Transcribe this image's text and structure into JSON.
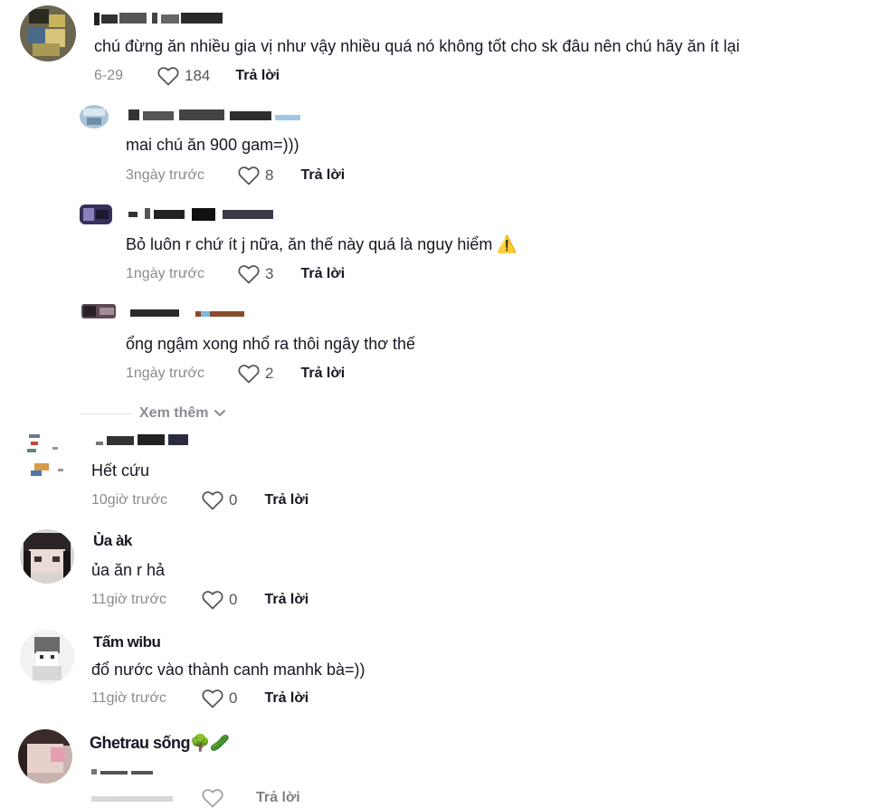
{
  "comments": [
    {
      "name": "",
      "text": "chú đừng ăn nhiều gia vị như vậy nhiều quá nó không tốt cho sk đâu nên chú hãy ăn ít lại",
      "time": "6-29",
      "likes": "184",
      "reply": "Trả lời"
    },
    {
      "name": "",
      "text": "mai chú ăn 900 gam=)))",
      "time": "3ngày trước",
      "likes": "8",
      "reply": "Trả lời"
    },
    {
      "name": "",
      "text": "Bỏ luôn r chứ ít j nữa, ăn thế này quá là nguy hiểm ⚠️",
      "time": "1ngày trước",
      "likes": "3",
      "reply": "Trả lời"
    },
    {
      "name": "",
      "text": "ổng ngậm xong nhổ ra thôi ngây thơ thế",
      "time": "1ngày trước",
      "likes": "2",
      "reply": "Trả lời"
    },
    {
      "name": "",
      "text": "Hết cứu",
      "time": "10giờ trước",
      "likes": "0",
      "reply": "Trả lời"
    },
    {
      "name": "Ủa àk",
      "text": "ủa ăn r hả",
      "time": "11giờ trước",
      "likes": "0",
      "reply": "Trả lời"
    },
    {
      "name": "Tấm wibu",
      "text": "đổ nước vào thành canh manhk bà=))",
      "time": "11giờ trước",
      "likes": "0",
      "reply": "Trả lời"
    },
    {
      "name": "Ghetrau sống🌳🥒",
      "text": "",
      "time": "",
      "likes": "",
      "reply": "Trả lời"
    }
  ],
  "see_more": "Xem thêm",
  "colors": {
    "text": "#161823",
    "muted": "#8a8b91",
    "divider": "#e3e3e4"
  },
  "icons": {
    "like": "heart-outline-icon",
    "expand": "chevron-down-icon"
  }
}
